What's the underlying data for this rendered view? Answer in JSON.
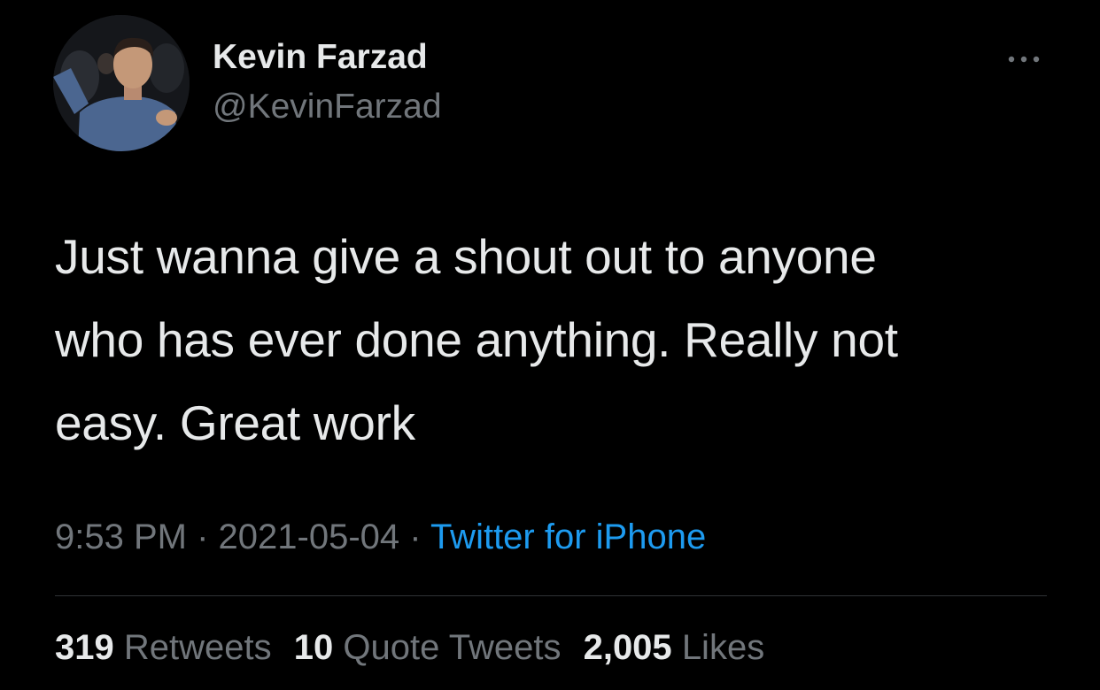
{
  "user": {
    "display_name": "Kevin Farzad",
    "handle": "@KevinFarzad"
  },
  "icons": {
    "more": "more-options-icon"
  },
  "tweet": {
    "lines": [
      "Just wanna give a shout out to anyone",
      "who has ever done anything. Really not",
      "easy. Great work"
    ],
    "time": "9:53 PM",
    "separator": " · ",
    "date": "2021-05-04",
    "source": "Twitter for iPhone"
  },
  "stats": {
    "retweets": {
      "count": "319",
      "label": "Retweets"
    },
    "quote_tweets": {
      "count": "10",
      "label": "Quote Tweets"
    },
    "likes": {
      "count": "2,005",
      "label": "Likes"
    }
  },
  "colors": {
    "background": "#000000",
    "text": "#e7e9ea",
    "secondary": "#71767b",
    "link": "#1d9bf0",
    "divider": "#2f3336"
  }
}
